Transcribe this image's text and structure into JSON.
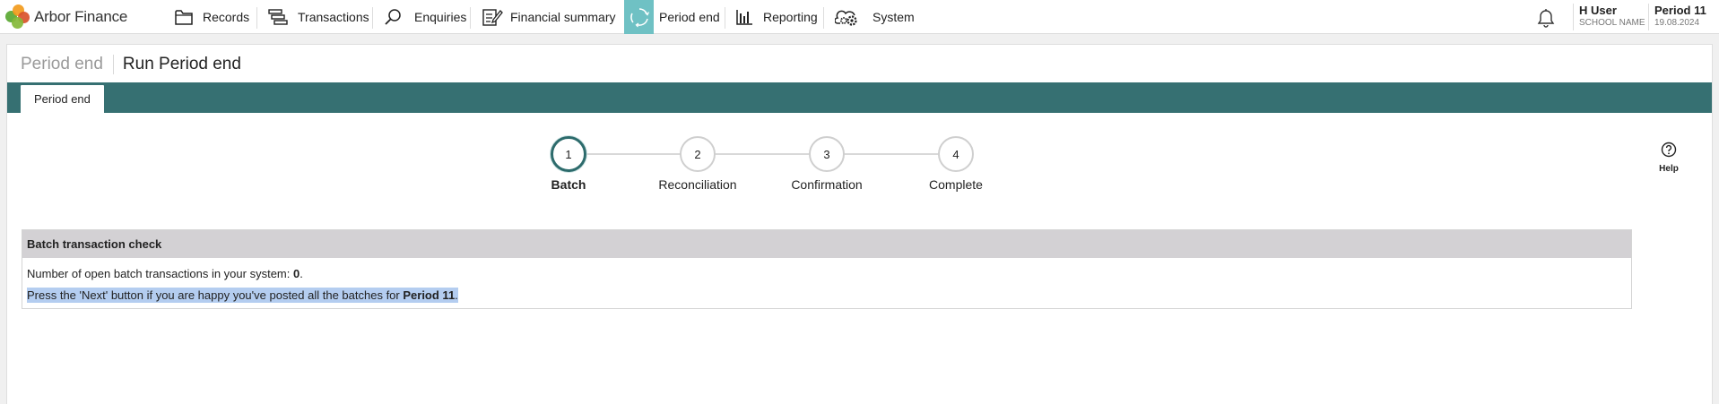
{
  "app": {
    "name": "Arbor Finance"
  },
  "nav": {
    "items": [
      {
        "label": "Records",
        "icon": "folder-icon"
      },
      {
        "label": "Transactions",
        "icon": "transactions-icon"
      },
      {
        "label": "Enquiries",
        "icon": "search-icon"
      },
      {
        "label": "Financial summary",
        "icon": "document-edit-icon"
      },
      {
        "label": "Period end",
        "icon": "refresh-cycle-icon",
        "active": true
      },
      {
        "label": "Reporting",
        "icon": "bar-chart-icon"
      },
      {
        "label": "System",
        "icon": "cloud-gear-icon"
      }
    ],
    "active_color": "#6fc1c4"
  },
  "user": {
    "name": "H User",
    "school": "SCHOOL NAME"
  },
  "period": {
    "label": "Period 11",
    "date": "19.08.2024"
  },
  "breadcrumb": {
    "parent": "Period end",
    "current": "Run Period end"
  },
  "tabs": [
    {
      "label": "Period end"
    }
  ],
  "tabbar_color": "#367072",
  "stepper": {
    "steps": [
      {
        "number": "1",
        "label": "Batch",
        "active": true
      },
      {
        "number": "2",
        "label": "Reconciliation"
      },
      {
        "number": "3",
        "label": "Confirmation"
      },
      {
        "number": "4",
        "label": "Complete"
      }
    ]
  },
  "help": {
    "label": "Help"
  },
  "batch_check": {
    "title": "Batch transaction check",
    "line1_prefix": "Number of open batch transactions in your system: ",
    "open_count": "0",
    "line1_suffix": ".",
    "line2_prefix": "Press the 'Next' button if you are happy you've posted all the batches for ",
    "line2_period": "Period 11",
    "line2_suffix": "."
  }
}
